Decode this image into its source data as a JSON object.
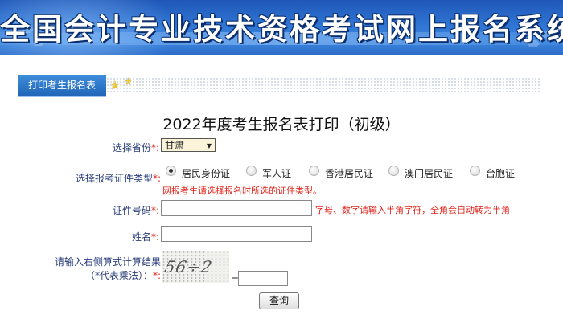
{
  "header": {
    "title": "全国会计专业技术资格考试网上报名系统"
  },
  "tab": {
    "label": "打印考生报名表"
  },
  "page": {
    "title": "2022年度考生报名表打印（初级）"
  },
  "form": {
    "province": {
      "label": "选择省份",
      "required_mark": "*:",
      "selected": "甘肃"
    },
    "id_type": {
      "label": "选择报考证件类型",
      "required_mark": "*:",
      "options": [
        "居民身份证",
        "军人证",
        "香港居民证",
        "澳门居民证",
        "台胞证"
      ],
      "selected_index": 0,
      "note": "网报考生请选择报名时所选的证件类型。"
    },
    "id_number": {
      "label": "证件号码",
      "required_mark": "*:",
      "value": "",
      "hint": "字母、数字请输入半角字符，全角会自动转为半角"
    },
    "name": {
      "label": "姓名",
      "required_mark": "*:",
      "value": ""
    },
    "captcha": {
      "label_line1": "请输入右侧算式计算结果",
      "label_line2": "（*代表乘法）：",
      "required_mark": "*:",
      "image_text": "56÷2",
      "equals": "=",
      "value": ""
    },
    "submit_label": "查询"
  },
  "colors": {
    "banner": "#2f74d2",
    "tab": "#2a73c4",
    "required": "#e0241b",
    "label": "#2b3f7a",
    "select_bg": "#fbf4d8"
  }
}
